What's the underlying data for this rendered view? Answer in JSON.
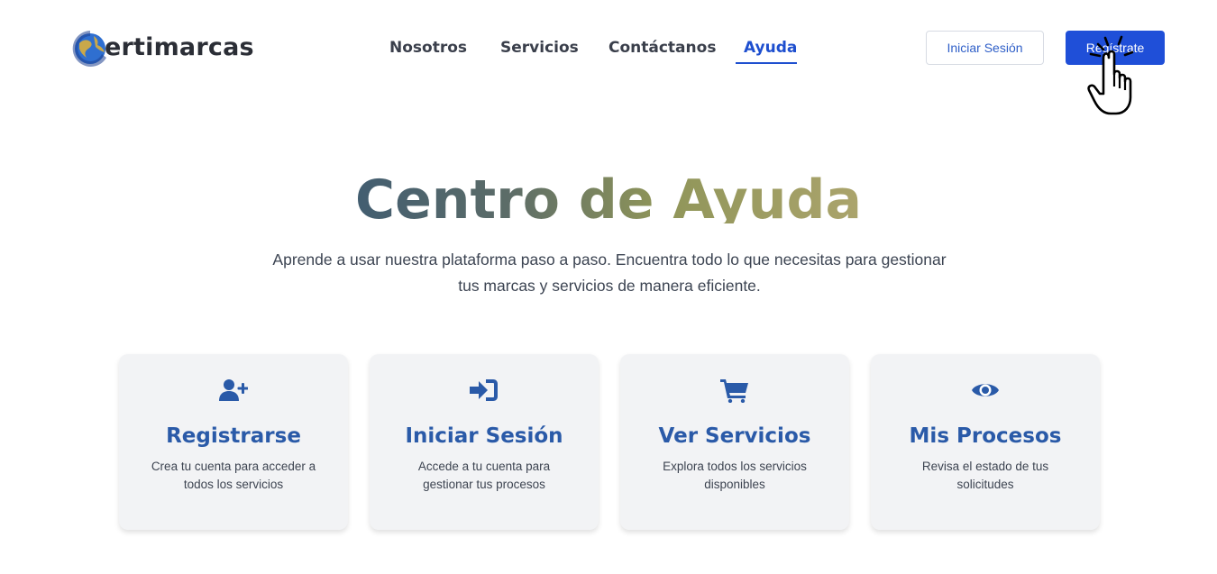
{
  "brand": {
    "logo_text": "ertimarcas",
    "logo_initial": "C"
  },
  "nav": {
    "items": [
      {
        "label": "Nosotros"
      },
      {
        "label": "Servicios"
      },
      {
        "label": "Contáctanos"
      },
      {
        "label": "Ayuda"
      }
    ],
    "active": "Ayuda"
  },
  "auth": {
    "login_label": "Iniciar Sesión",
    "register_label": "Regístrate"
  },
  "hero": {
    "title": "Centro de Ayuda",
    "subtitle": "Aprende a usar nuestra plataforma paso a paso. Encuentra todo lo que necesitas para gestionar tus marcas y servicios de manera eficiente."
  },
  "cards": [
    {
      "icon": "user-plus-icon",
      "title": "Registrarse",
      "description": "Crea tu cuenta para acceder a todos los servicios"
    },
    {
      "icon": "sign-in-icon",
      "title": "Iniciar Sesión",
      "description": "Accede a tu cuenta para gestionar tus procesos"
    },
    {
      "icon": "cart-icon",
      "title": "Ver Servicios",
      "description": "Explora todos los servicios disponibles"
    },
    {
      "icon": "eye-icon",
      "title": "Mis Procesos",
      "description": "Revisa el estado de tus solicitudes"
    }
  ],
  "colors": {
    "primary": "#1f4fd8",
    "card_title": "#2a5aa8",
    "card_bg": "#f2f3f5",
    "nav_active": "#1e4fcf"
  }
}
